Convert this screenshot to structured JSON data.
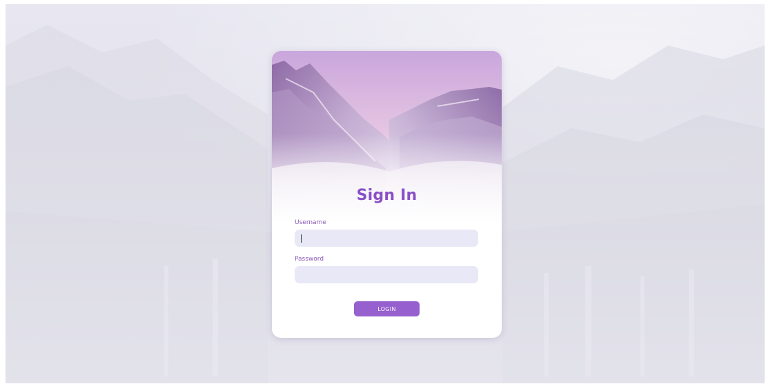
{
  "login_card": {
    "title": "Sign In",
    "username": {
      "label": "Username",
      "value": ""
    },
    "password": {
      "label": "Password",
      "value": ""
    },
    "login_button_label": "LOGIN"
  },
  "colors": {
    "accent": "#9660cf",
    "title": "#8a4fc8",
    "input_background": "#e9e8f6",
    "label": "#8a5ab8"
  }
}
